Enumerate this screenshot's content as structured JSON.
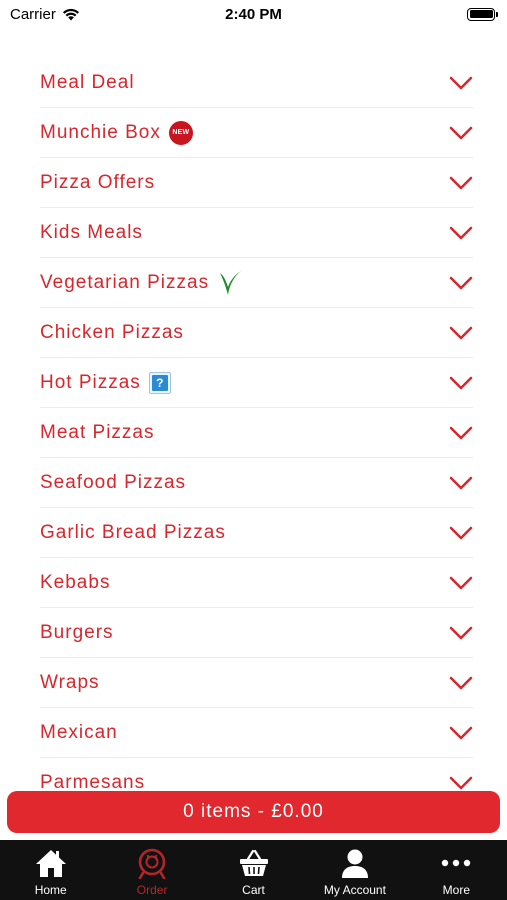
{
  "status_bar": {
    "carrier": "Carrier",
    "time": "2:40 PM"
  },
  "colors": {
    "accent": "#d8262c",
    "cart_bar": "#e0282e",
    "tab_bar": "#111111",
    "tab_active": "#b5262b"
  },
  "menu": {
    "items": [
      {
        "label": "Meal Deal"
      },
      {
        "label": "Munchie Box",
        "badge": "new",
        "badge_text": "NEW"
      },
      {
        "label": "Pizza Offers"
      },
      {
        "label": "Kids Meals"
      },
      {
        "label": "Vegetarian Pizzas",
        "badge": "vegetarian-icon"
      },
      {
        "label": "Chicken Pizzas"
      },
      {
        "label": "Hot Pizzas",
        "badge": "help-icon",
        "badge_text": "?"
      },
      {
        "label": "Meat Pizzas"
      },
      {
        "label": "Seafood Pizzas"
      },
      {
        "label": "Garlic Bread Pizzas"
      },
      {
        "label": "Kebabs"
      },
      {
        "label": "Burgers"
      },
      {
        "label": "Wraps"
      },
      {
        "label": "Mexican"
      },
      {
        "label": "Parmesans"
      }
    ]
  },
  "cart": {
    "summary": "0 items - £0.00"
  },
  "tabs": [
    {
      "label": "Home",
      "icon": "home-icon"
    },
    {
      "label": "Order",
      "icon": "order-icon",
      "active": true
    },
    {
      "label": "Cart",
      "icon": "basket-icon"
    },
    {
      "label": "My Account",
      "icon": "user-icon"
    },
    {
      "label": "More",
      "icon": "more-icon"
    }
  ]
}
